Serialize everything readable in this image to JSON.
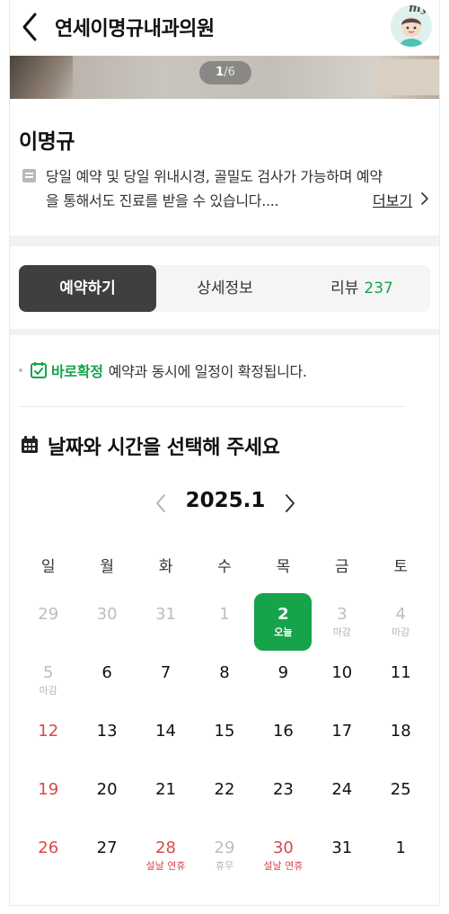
{
  "header": {
    "title": "연세이명규내과의원",
    "avatar_label": "my"
  },
  "photo": {
    "current": "1",
    "separator": "/",
    "total": "6"
  },
  "doctor": {
    "name": "이명규",
    "description": "당일 예약 및 당일 위내시경, 골밀도 검사가 가능하며 예약을 통해서도 진료를 받을 수 있습니다....",
    "more_label": "더보기"
  },
  "tabs": [
    {
      "label": "예약하기",
      "active": true
    },
    {
      "label": "상세정보",
      "active": false
    },
    {
      "label": "리뷰",
      "count": "237",
      "active": false
    }
  ],
  "confirm": {
    "badge": "바로확정",
    "text": "예약과 동시에 일정이 확정됩니다."
  },
  "section_title": "날짜와 시간을 선택해 주세요",
  "calendar": {
    "month_label": "2025.1",
    "weekdays": [
      "일",
      "월",
      "화",
      "수",
      "목",
      "금",
      "토"
    ],
    "weeks": [
      [
        {
          "num": "29",
          "sub": "",
          "state": "muted"
        },
        {
          "num": "30",
          "sub": "",
          "state": "muted"
        },
        {
          "num": "31",
          "sub": "",
          "state": "muted"
        },
        {
          "num": "1",
          "sub": "",
          "state": "muted"
        },
        {
          "num": "2",
          "sub": "오늘",
          "state": "selected"
        },
        {
          "num": "3",
          "sub": "마감",
          "state": "muted"
        },
        {
          "num": "4",
          "sub": "마감",
          "state": "muted"
        }
      ],
      [
        {
          "num": "5",
          "sub": "마감",
          "state": "muted"
        },
        {
          "num": "6",
          "sub": "",
          "state": "normal"
        },
        {
          "num": "7",
          "sub": "",
          "state": "normal"
        },
        {
          "num": "8",
          "sub": "",
          "state": "normal"
        },
        {
          "num": "9",
          "sub": "",
          "state": "normal"
        },
        {
          "num": "10",
          "sub": "",
          "state": "normal"
        },
        {
          "num": "11",
          "sub": "",
          "state": "normal"
        }
      ],
      [
        {
          "num": "12",
          "sub": "",
          "state": "sunday"
        },
        {
          "num": "13",
          "sub": "",
          "state": "normal"
        },
        {
          "num": "14",
          "sub": "",
          "state": "normal"
        },
        {
          "num": "15",
          "sub": "",
          "state": "normal"
        },
        {
          "num": "16",
          "sub": "",
          "state": "normal"
        },
        {
          "num": "17",
          "sub": "",
          "state": "normal"
        },
        {
          "num": "18",
          "sub": "",
          "state": "normal"
        }
      ],
      [
        {
          "num": "19",
          "sub": "",
          "state": "sunday"
        },
        {
          "num": "20",
          "sub": "",
          "state": "normal"
        },
        {
          "num": "21",
          "sub": "",
          "state": "normal"
        },
        {
          "num": "22",
          "sub": "",
          "state": "normal"
        },
        {
          "num": "23",
          "sub": "",
          "state": "normal"
        },
        {
          "num": "24",
          "sub": "",
          "state": "normal"
        },
        {
          "num": "25",
          "sub": "",
          "state": "normal"
        }
      ],
      [
        {
          "num": "26",
          "sub": "",
          "state": "sunday"
        },
        {
          "num": "27",
          "sub": "",
          "state": "normal"
        },
        {
          "num": "28",
          "sub": "설날 연휴",
          "state": "holiday"
        },
        {
          "num": "29",
          "sub": "휴무",
          "state": "muted"
        },
        {
          "num": "30",
          "sub": "설날 연휴",
          "state": "holiday"
        },
        {
          "num": "31",
          "sub": "",
          "state": "normal"
        },
        {
          "num": "1",
          "sub": "",
          "state": "normal"
        }
      ]
    ]
  },
  "colors": {
    "accent_green": "#16a34a",
    "holiday_red": "#d9484b",
    "active_tab": "#3f3f42"
  },
  "icons": {
    "back": "chevron-left-icon",
    "description": "memo-icon",
    "more": "chevron-right-icon",
    "confirm": "checkbox-calendar-icon",
    "section": "calendar-icon",
    "prev": "chevron-left-icon",
    "next": "chevron-right-icon"
  }
}
